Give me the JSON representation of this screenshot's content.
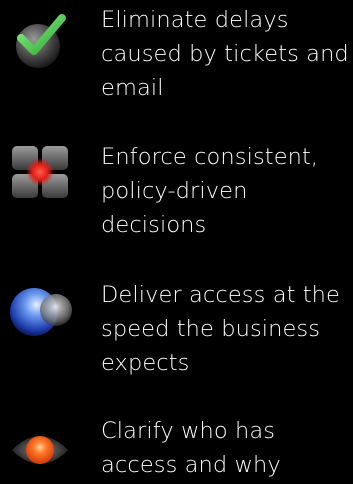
{
  "features": [
    {
      "icon": "check-circle-icon",
      "lines": [
        "Eliminate delays",
        "caused by tickets and",
        "email"
      ]
    },
    {
      "icon": "policy-grid-icon",
      "lines": [
        "Enforce consistent,",
        "policy-driven",
        "decisions"
      ]
    },
    {
      "icon": "overlapping-circles-icon",
      "lines": [
        "Deliver access at the",
        "speed the business",
        "expects"
      ]
    },
    {
      "icon": "eye-icon",
      "lines": [
        "Clarify who has",
        "access and why"
      ]
    }
  ],
  "colors": {
    "background": "#000000",
    "text": "#ffffff",
    "check_green": "#4fd14f",
    "accent_red": "#e0201a",
    "accent_blue": "#1f5fd8",
    "accent_orange": "#ff6a1a"
  }
}
